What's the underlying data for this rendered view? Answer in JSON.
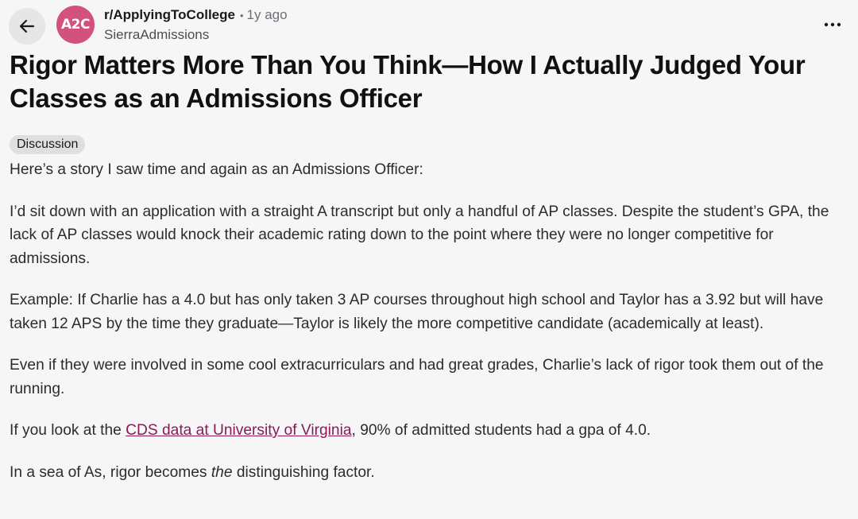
{
  "header": {
    "subreddit": "r/ApplyingToCollege",
    "separator": "•",
    "time_ago": "1y ago",
    "author": "SierraAdmissions",
    "avatar_text": "A2C",
    "back_icon": "arrow-left-icon",
    "more_icon": "ellipsis-horizontal-icon"
  },
  "post": {
    "title": "Rigor Matters More Than You Think—How I Actually Judged Your Classes as an Admissions Officer",
    "flair": "Discussion",
    "paragraphs": {
      "p1": "Here’s a story I saw time and again as an Admissions Officer:",
      "p2": "I’d sit down with an application with a straight A transcript but only a handful of AP classes. Despite the student’s GPA, the lack of AP classes would knock their academic rating down to the point where they were no longer competitive for admissions.",
      "p3": "Example: If Charlie has a 4.0 but has only taken 3 AP courses throughout high school and Taylor has a 3.92 but will have taken 12 APS by the time they graduate—Taylor is likely the more competitive candidate (academically at least).",
      "p4": "Even if they were involved in some cool extracurriculars and had great grades, Charlie’s lack of rigor took them out of the running.",
      "p5_before": "If you look at the ",
      "p5_link": "CDS data at University of Virginia",
      "p5_after": ", 90% of admitted students had a gpa of 4.0.",
      "p6_before": "In a sea of As, rigor becomes ",
      "p6_em": "the",
      "p6_after": " distinguishing factor."
    }
  },
  "colors": {
    "background": "#f6f6f7",
    "avatar": "#d3517f",
    "link": "#8b1a55",
    "flair_bg": "#dedfe1"
  }
}
